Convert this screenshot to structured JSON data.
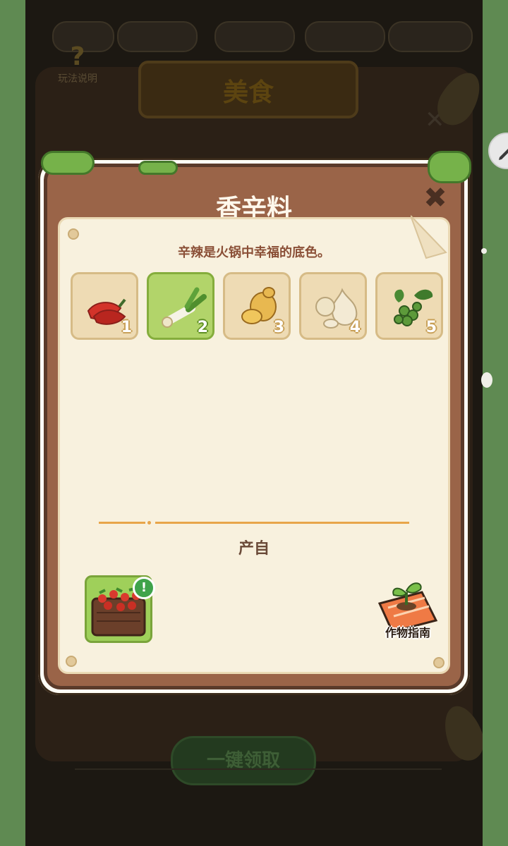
{
  "background": {
    "help_label": "玩法说明",
    "help_icon": "question-icon",
    "title": "美食",
    "claim_button": "一键领取"
  },
  "modal": {
    "title": "香辛料",
    "close_icon": "close-icon",
    "description": "辛辣是火锅中幸福的底色。",
    "items": [
      {
        "icon": "chili-pepper-icon",
        "number": "1"
      },
      {
        "icon": "scallion-icon",
        "number": "2"
      },
      {
        "icon": "ginger-icon",
        "number": "3"
      },
      {
        "icon": "garlic-icon",
        "number": "4"
      },
      {
        "icon": "sichuan-pepper-icon",
        "number": "5"
      }
    ],
    "selected_index": 2,
    "origin_label": "产自",
    "source_icon": "tomato-farm-plot-icon",
    "badge_text": "!",
    "guide_label": "作物指南"
  },
  "colors": {
    "modal_frame": "#9a6448",
    "paper": "#f8f1de",
    "selected_slot": "#b2d46a",
    "accent_line": "#e8a54a"
  }
}
